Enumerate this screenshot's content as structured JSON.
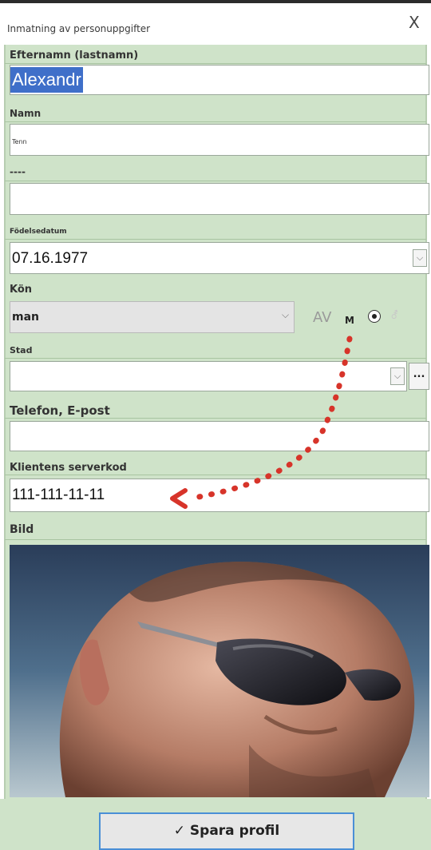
{
  "window": {
    "title": "Inmatning av personuppgifter",
    "close_glyph": "X"
  },
  "form": {
    "lastname": {
      "label": "Efternamn (lastnamn)",
      "value": "Alexandr"
    },
    "name": {
      "label": "Namn",
      "value": "Tenn"
    },
    "extra": {
      "label": "----",
      "value": ""
    },
    "birthdate": {
      "label": "Födelsedatum",
      "value": "07.16.1977"
    },
    "gender": {
      "label": "Kön",
      "value": "man",
      "av_label": "AV",
      "m_label": "M",
      "symbol": "⚦"
    },
    "city": {
      "label": "Stad",
      "value": "",
      "browse_label": "..."
    },
    "contact": {
      "label": "Telefon, E-post",
      "value": ""
    },
    "server_code": {
      "label": "Klientens serverkod",
      "value": "111-111-11-11"
    },
    "photo": {
      "label": "Bild"
    }
  },
  "footer": {
    "save_label": "✓ Spara profil"
  },
  "colors": {
    "panel": "#cfe3c9",
    "selection": "#3f6fc9",
    "arrow": "#d7342a",
    "save_border": "#4a8fd6"
  }
}
